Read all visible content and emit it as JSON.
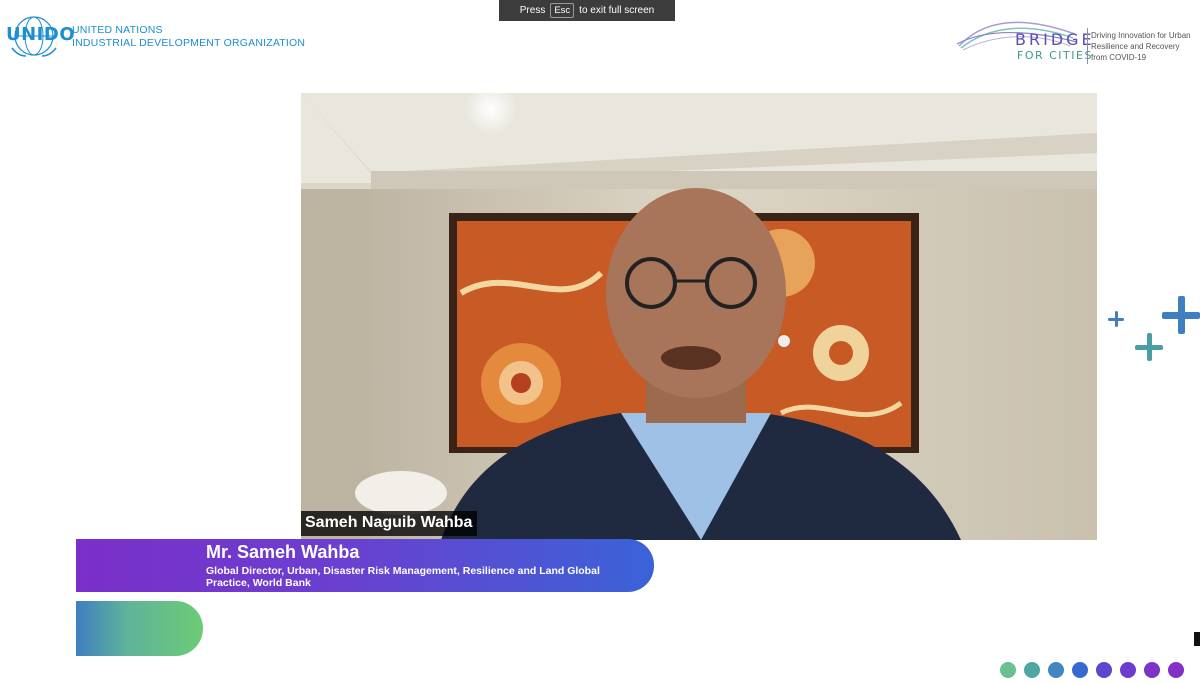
{
  "header": {
    "org_logo_text": "UNIDO",
    "org_line1": "UNITED NATIONS",
    "org_line2": "INDUSTRIAL DEVELOPMENT ORGANIZATION"
  },
  "fullscreen_hint": {
    "prefix": "Press",
    "key": "Esc",
    "suffix": "to exit full screen"
  },
  "event_logo": {
    "word1": "BRIDGE",
    "word2": "FOR CITIES",
    "tagline": "Driving Innovation for Urban Resilience and Recovery from COVID-19"
  },
  "video": {
    "participant_name": "Sameh Naguib Wahba"
  },
  "lower_third": {
    "name": "Mr. Sameh Wahba",
    "role": "Global Director, Urban, Disaster Risk Management, Resilience and Land Global Practice, World Bank"
  },
  "colors": {
    "brand_blue": "#1a8fd1",
    "banner_purple": "#7a2fc9",
    "banner_blue": "#3a63d8",
    "plus_blue": "#3f7fc0",
    "plus_green": "#5fb39a",
    "dots": [
      "#6cbf8e",
      "#4fa6a3",
      "#3f86c2",
      "#3668cf",
      "#5a48cf",
      "#6b3ccd",
      "#7a34c8",
      "#8231c6"
    ]
  }
}
